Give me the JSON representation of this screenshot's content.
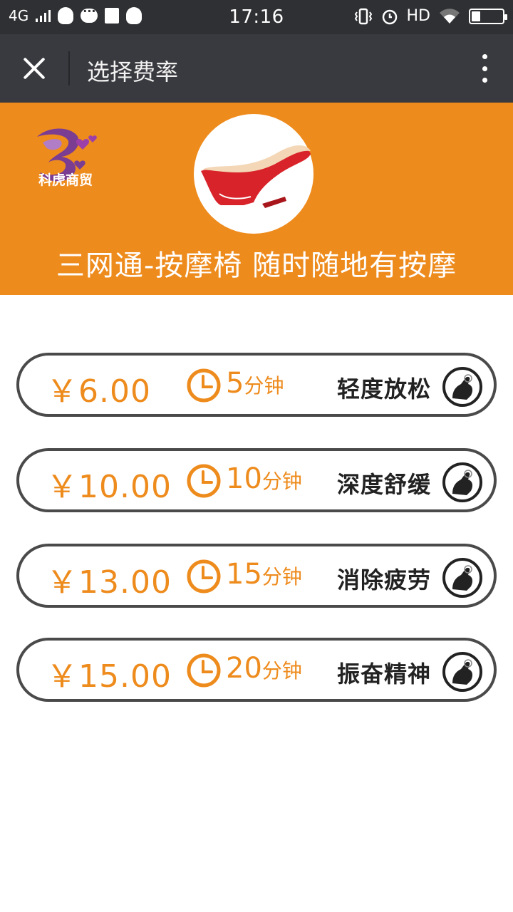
{
  "status_bar": {
    "network": "4G",
    "time": "17:16",
    "hd": "HD"
  },
  "nav": {
    "title": "选择费率"
  },
  "banner": {
    "logo_text": "科虎商贸",
    "caption": "三网通-按摩椅 随时随地有按摩",
    "accent_color": "#ee8b1d"
  },
  "rates": [
    {
      "price": "￥6.00",
      "minutes": "5",
      "unit": "分钟",
      "label": "轻度放松"
    },
    {
      "price": "￥10.00",
      "minutes": "10",
      "unit": "分钟",
      "label": "深度舒缓"
    },
    {
      "price": "￥13.00",
      "minutes": "15",
      "unit": "分钟",
      "label": "消除疲劳"
    },
    {
      "price": "￥15.00",
      "minutes": "20",
      "unit": "分钟",
      "label": "振奋精神"
    }
  ]
}
